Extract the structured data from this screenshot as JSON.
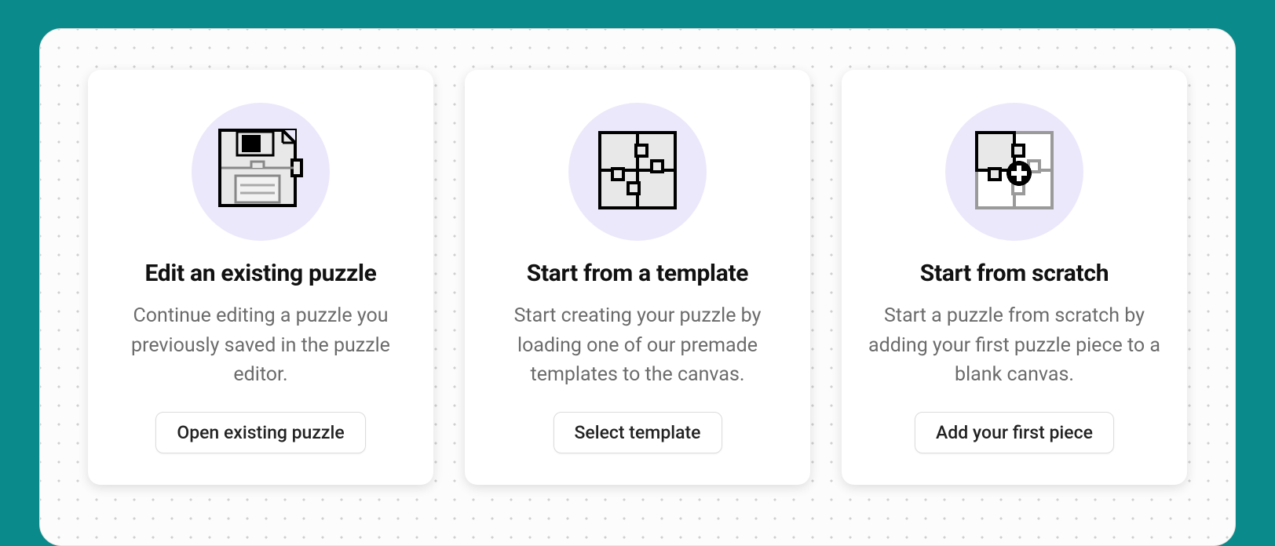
{
  "cards": [
    {
      "icon": "floppy-puzzle-icon",
      "title": "Edit an existing puzzle",
      "description": "Continue editing a puzzle you previously saved in the puzzle editor.",
      "button_label": "Open existing puzzle"
    },
    {
      "icon": "puzzle-template-icon",
      "title": "Start from a template",
      "description": "Start creating your puzzle by loading one of our premade templates to the canvas.",
      "button_label": "Select template"
    },
    {
      "icon": "puzzle-add-icon",
      "title": "Start from scratch",
      "description": "Start a puzzle from scratch by adding your first puzzle piece to a blank canvas.",
      "button_label": "Add your first piece"
    }
  ],
  "colors": {
    "page_bg": "#0a8a8a",
    "panel_bg": "#fcfcfc",
    "card_bg": "#ffffff",
    "icon_circle_bg": "#ece8fb",
    "title_color": "#111111",
    "desc_color": "#6b6b6b"
  }
}
